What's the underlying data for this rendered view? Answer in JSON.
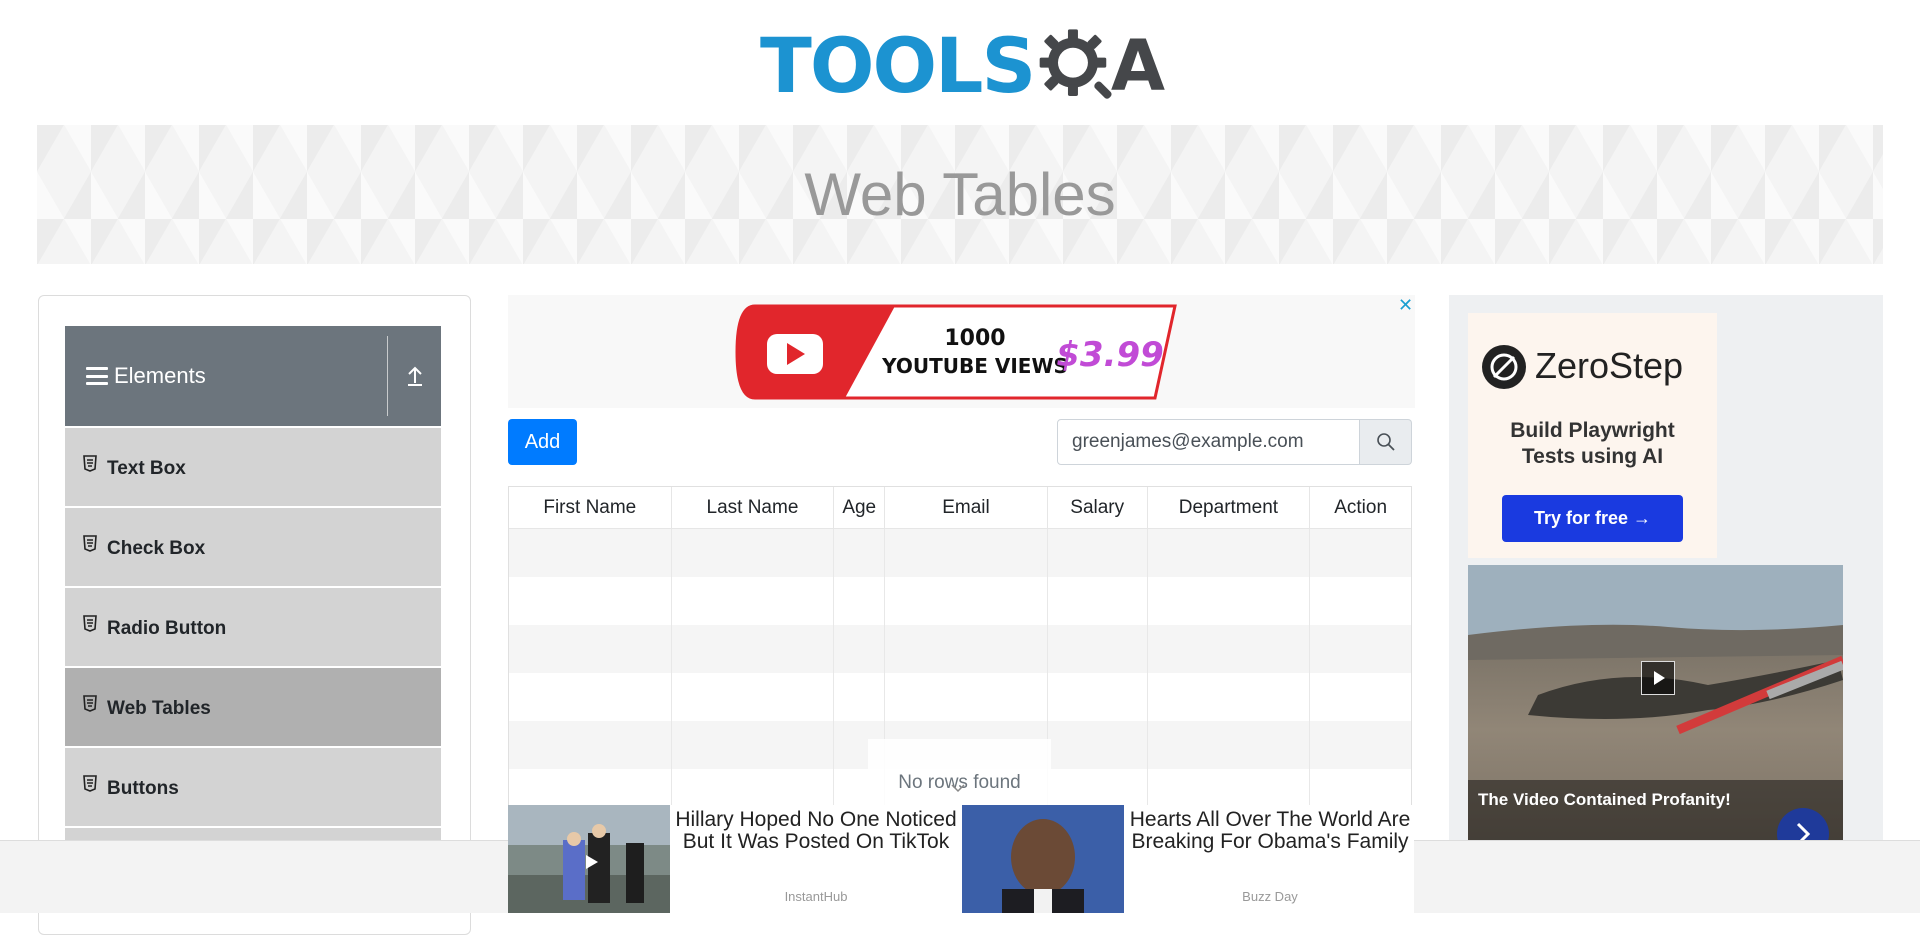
{
  "logo": {
    "tools_text": "TOOLS",
    "a_text": "A"
  },
  "banner": {
    "title": "Web Tables"
  },
  "sidebar": {
    "group_title": "Elements",
    "items": [
      {
        "label": "Text Box"
      },
      {
        "label": "Check Box"
      },
      {
        "label": "Radio Button"
      },
      {
        "label": "Web Tables",
        "active": true
      },
      {
        "label": "Buttons"
      }
    ]
  },
  "toolbar": {
    "add_label": "Add"
  },
  "search": {
    "value": "greenjames@example.com"
  },
  "table": {
    "columns": [
      "First Name",
      "Last Name",
      "Age",
      "Email",
      "Salary",
      "Department",
      "Action"
    ],
    "empty_message": "No rows found"
  },
  "ads": {
    "youtube": {
      "line1": "1000",
      "line2": "YOUTUBE VIEWS",
      "price": "$3.99"
    },
    "zerostep": {
      "brand": "ZeroStep",
      "tagline_line1": "Build Playwright",
      "tagline_line2": "Tests using AI",
      "cta": "Try for free →"
    },
    "video": {
      "caption": "The Video Contained Profanity!"
    },
    "stories": [
      {
        "headline": "Hillary Hoped No One Noticed But It Was Posted On TikTok",
        "source": "InstantHub"
      },
      {
        "headline": "Hearts All Over The World Are Breaking For Obama's Family",
        "source": "Buzz Day"
      }
    ]
  },
  "colors": {
    "primary": "#007bff",
    "brand_blue": "#1c93d1",
    "sidebar_header": "#6c757d",
    "menu_item": "#d3d3d3"
  }
}
